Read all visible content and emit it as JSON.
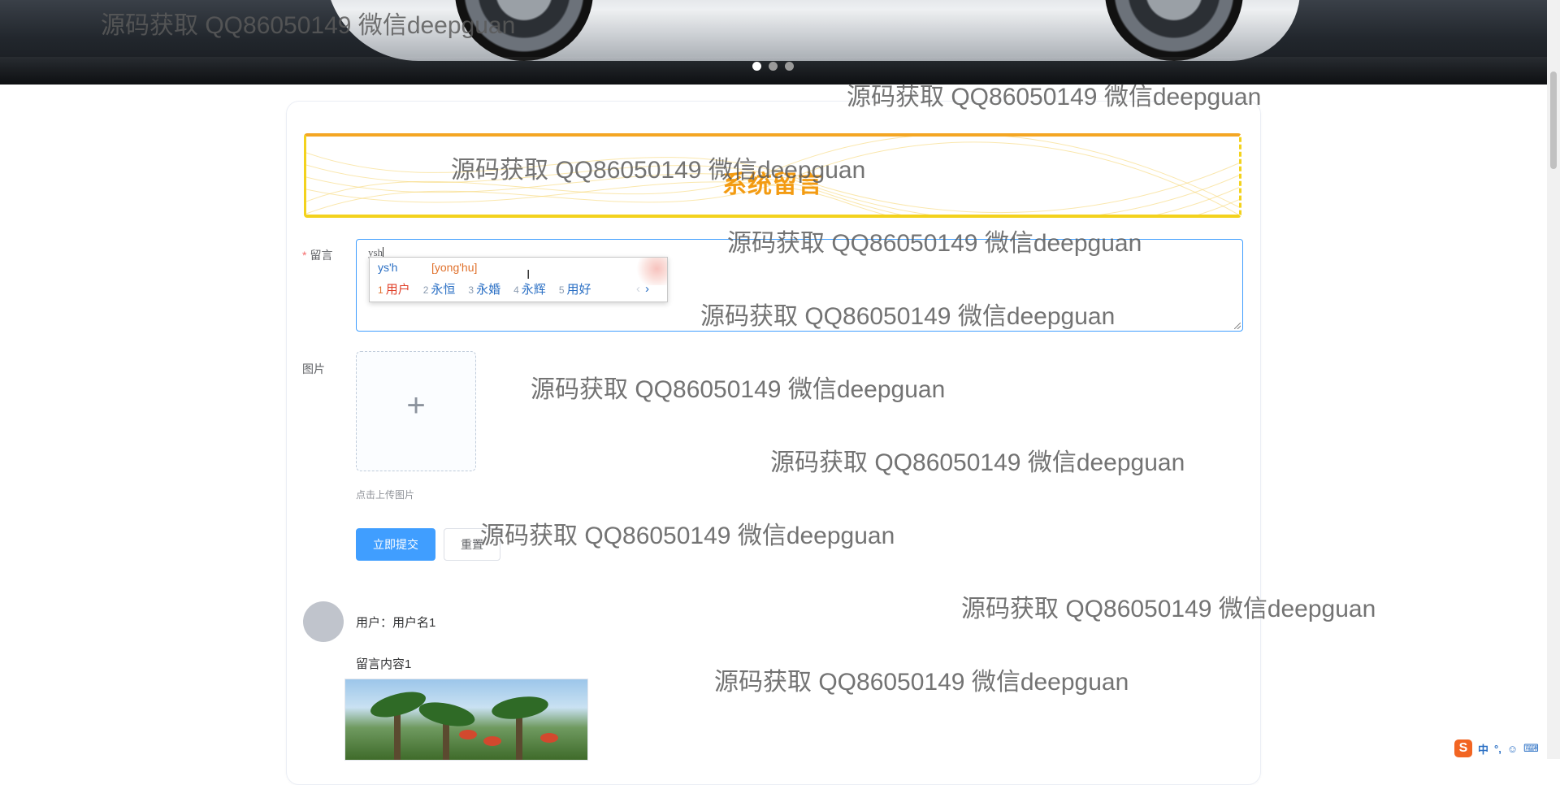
{
  "banner": {
    "carousel_total": 3,
    "carousel_active": 1
  },
  "title": "系统留言",
  "form": {
    "message_label": "留言",
    "required_mark": "*",
    "message_value": "ysh",
    "image_label": "图片",
    "upload_plus": "+",
    "upload_tip": "点击上传图片",
    "submit_label": "立即提交",
    "reset_label": "重置"
  },
  "ime": {
    "input": "ys'h",
    "pinyin": "[yong'hu]",
    "candidates": [
      {
        "num": "1",
        "text": "用户"
      },
      {
        "num": "2",
        "text": "永恒"
      },
      {
        "num": "3",
        "text": "永婚"
      },
      {
        "num": "4",
        "text": "永辉"
      },
      {
        "num": "5",
        "text": "用好"
      }
    ],
    "prev": "‹",
    "next": "›"
  },
  "comment": {
    "user": "用户：用户名1",
    "content": "留言内容1"
  },
  "watermark": "源码获取 QQ86050149 微信deepguan",
  "tray": {
    "app_logo": "S",
    "lang": "中",
    "punct": "°,",
    "emoji_icon": "smiley-icon",
    "keyboard_icon": "keyboard-icon"
  },
  "colors": {
    "primary": "#409eff",
    "title": "#f39b12",
    "ime_blue": "#2a6fc4",
    "ime_orange": "#e0712c"
  }
}
